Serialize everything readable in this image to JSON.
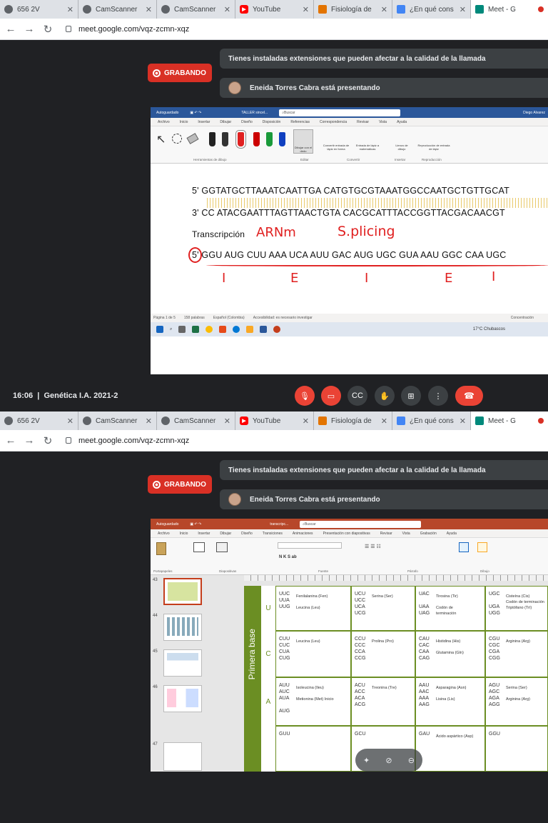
{
  "tabs": [
    {
      "label": "656 2V",
      "color": "#5f6368"
    },
    {
      "label": "CamScanner",
      "color": "#5f6368"
    },
    {
      "label": "CamScanner",
      "color": "#5f6368"
    },
    {
      "label": "YouTube",
      "color": "#ff0000"
    },
    {
      "label": "Fisiología de",
      "color": "#e37400"
    },
    {
      "label": "¿En qué cons",
      "color": "#4285f4"
    },
    {
      "label": "Meet - G",
      "color": "#00897b"
    }
  ],
  "url": "meet.google.com/vqz-zcmn-xqz",
  "meet": {
    "extension_warning": "Tienes instaladas extensiones que pueden afectar a la calidad de la llamada",
    "recording_label": "GRABANDO",
    "presenter": "Eneida Torres Cabra está presentando",
    "clock": "16:06",
    "meeting_name": "Genética I.A. 2021-2"
  },
  "word": {
    "autosave": "Autoguardado",
    "file_title": "TALLER sincel...",
    "search": "Buscar",
    "user": "Diego Alvarez",
    "menus": [
      "Archivo",
      "Inicio",
      "Insertar",
      "Dibujar",
      "Diseño",
      "Disposición",
      "Referencias",
      "Correspondencia",
      "Revisar",
      "Vista",
      "Ayuda"
    ],
    "ribbon_groups": [
      "Herramientas de dibujo",
      "Editar",
      "Convertir",
      "Insertar",
      "Reproducción"
    ],
    "ribbon_buttons": [
      "Dibujar con el dedo",
      "Convertir entrada de lápiz en forma",
      "Entrada de lápiz a matemáticas",
      "Lienzo de dibujo",
      "Reproducción de entrada de lápiz"
    ],
    "line1": "5' GGTATGCTTAAATCAATTGA CATGTGCGTAAATGGCCAATGCTGTTGCAT",
    "line2": "3' CC ATACGAATTTAGTTAACTGTA CACGCATTTACCGGTTACGACAACGT",
    "transcripcion": "Transcripción",
    "arnm": "ARNm",
    "splicing": "S.plicing",
    "rna_line": "5' GGU AUG CUU AAA UCA AUU GAC AUG UGC GUA AAU GGC CAA UGC",
    "marks": [
      "I",
      "E",
      "I",
      "E",
      "I"
    ],
    "status_left": "Página 1 de 5",
    "status_words": "158 palabras",
    "status_lang": "Español (Colombia)",
    "status_access": "Accesibilidad: es necesario investigar",
    "status_focus": "Concentración",
    "weather": "17°C Chubascos"
  },
  "ppt": {
    "file_title": "transcripc...",
    "search": "Buscar",
    "menus": [
      "Archivo",
      "Inicio",
      "Insertar",
      "Dibujar",
      "Diseño",
      "Transiciones",
      "Animaciones",
      "Presentación con diapositivas",
      "Revisar",
      "Vista",
      "Grabación",
      "Ayuda"
    ],
    "ribbon_groups": [
      "Portapapeles",
      "Diapositivas",
      "Fuente",
      "Párrafo",
      "Dibujo"
    ],
    "slide_numbers": [
      "43",
      "44",
      "45",
      "46",
      "47"
    ],
    "primera_base": "Primera base",
    "rows": [
      {
        "letter": "U",
        "cells": [
          {
            "codons": "UUC\nUUA\nUUG",
            "aa": "Fenilalanina (Fen)\n\nLeucina (Leu)"
          },
          {
            "codons": "UCU\nUCC\nUCA\nUCG",
            "aa": "Serina (Ser)"
          },
          {
            "codons": "UAC\n\nUAA\nUAG",
            "aa": "Tirosina (Tir)\n\nCodón de\nterminación"
          },
          {
            "codons": "UGC\n\nUGA\nUGG",
            "aa": "Cisteína (Cis)\nCodón de terminación\nTriptófano (Trí)"
          }
        ]
      },
      {
        "letter": "C",
        "cells": [
          {
            "codons": "CUU\nCUC\nCUA\nCUG",
            "aa": "Leucina (Leu)"
          },
          {
            "codons": "CCU\nCCC\nCCA\nCCG",
            "aa": "Prolina (Pro)"
          },
          {
            "codons": "CAU\nCAC\nCAA\nCAG",
            "aa": "Histidina (His)\n\nGlutamina (Gln)"
          },
          {
            "codons": "CGU\nCGC\nCGA\nCGG",
            "aa": "Arginina (Arg)"
          }
        ]
      },
      {
        "letter": "A",
        "cells": [
          {
            "codons": "AUU\nAUC\nAUA\n\nAUG",
            "aa": "Isoleucina (Ileu)\n\nMetionina (Met) Inicio"
          },
          {
            "codons": "ACU\nACC\nACA\nACG",
            "aa": "Treonina (Tre)"
          },
          {
            "codons": "AAU\nAAC\nAAA\nAAG",
            "aa": "Asparagina (Asn)\n\nLisina (Lis)"
          },
          {
            "codons": "AGU\nAGC\nAGA\nAGG",
            "aa": "Serina (Ser)\n\nArginina (Arg)"
          }
        ]
      },
      {
        "letter": "",
        "cells": [
          {
            "codons": "GUU",
            "aa": ""
          },
          {
            "codons": "GCU",
            "aa": ""
          },
          {
            "codons": "GAU",
            "aa": "Ácido aspártico (Asp)"
          },
          {
            "codons": "GGU",
            "aa": ""
          }
        ]
      }
    ]
  }
}
